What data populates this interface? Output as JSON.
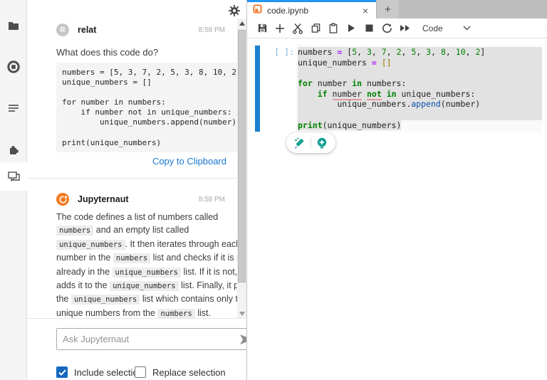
{
  "colors": {
    "accent_blue": "#2196f3",
    "brand_orange": "#f57c22",
    "teal_ai": "#12a192",
    "keyword_green": "#008000",
    "operator_magenta": "#aa22ff",
    "function_blue": "#0550ae",
    "selection_gray": "#e2e2e2",
    "checkbox_blue": "#1667c0"
  },
  "sidebar": {
    "items": [
      {
        "name": "file-browser"
      },
      {
        "name": "running-kernels"
      },
      {
        "name": "table-of-contents"
      },
      {
        "name": "extension-manager"
      },
      {
        "name": "chat",
        "selected": true
      }
    ]
  },
  "chat": {
    "user_message": {
      "author": "relat",
      "avatar_initial": "R",
      "time": "8:58 PM",
      "question": "What does this code do?",
      "code": "numbers = [5, 3, 7, 2, 5, 3, 8, 10, 2]\nunique_numbers = []\n\nfor number in numbers:\n    if number not in unique_numbers:\n        unique_numbers.append(number)\n\nprint(unique_numbers)",
      "copy_label": "Copy to Clipboard"
    },
    "ai_message": {
      "author": "Jupyternaut",
      "time": "8:58 PM",
      "segments": [
        {
          "type": "text",
          "text": "The code defines a list of numbers called "
        },
        {
          "type": "code",
          "text": "numbers"
        },
        {
          "type": "text",
          "text": " and an empty list called "
        },
        {
          "type": "code",
          "text": "unique_numbers"
        },
        {
          "type": "text",
          "text": ". It then iterates through each number in the "
        },
        {
          "type": "code",
          "text": "numbers"
        },
        {
          "type": "text",
          "text": " list and checks if it is not already in the "
        },
        {
          "type": "code",
          "text": "unique_numbers"
        },
        {
          "type": "text",
          "text": " list. If it is not, it adds it to the "
        },
        {
          "type": "code",
          "text": "unique_numbers"
        },
        {
          "type": "text",
          "text": " list. Finally, it prints the "
        },
        {
          "type": "code",
          "text": "unique_numbers"
        },
        {
          "type": "text",
          "text": " list which contains only the unique numbers from the "
        },
        {
          "type": "code",
          "text": "numbers"
        },
        {
          "type": "text",
          "text": " list."
        }
      ]
    },
    "input": {
      "placeholder": "Ask Jupyternaut",
      "value": ""
    },
    "checkboxes": [
      {
        "label": "Include selection",
        "checked": true
      },
      {
        "label": "Replace selection",
        "checked": false
      }
    ]
  },
  "notebook": {
    "tab": {
      "title": "code.ipynb"
    },
    "new_tab_label": "+",
    "toolbar": {
      "celltype": "Code"
    },
    "cell": {
      "prompt": "[ ]:",
      "lines": [
        {
          "sel": "full",
          "tokens": [
            {
              "t": "numbers "
            },
            {
              "t": "=",
              "c": "op"
            },
            {
              "t": " ["
            },
            {
              "t": "5",
              "c": "num"
            },
            {
              "t": ", "
            },
            {
              "t": "3",
              "c": "num"
            },
            {
              "t": ", "
            },
            {
              "t": "7",
              "c": "num"
            },
            {
              "t": ", "
            },
            {
              "t": "2",
              "c": "num"
            },
            {
              "t": ", "
            },
            {
              "t": "5",
              "c": "num"
            },
            {
              "t": ", "
            },
            {
              "t": "3",
              "c": "num"
            },
            {
              "t": ", "
            },
            {
              "t": "8",
              "c": "num"
            },
            {
              "t": ", "
            },
            {
              "t": "10",
              "c": "num"
            },
            {
              "t": ", "
            },
            {
              "t": "2",
              "c": "num"
            },
            {
              "t": "]"
            }
          ]
        },
        {
          "sel": "full",
          "tokens": [
            {
              "t": "unique_numbers "
            },
            {
              "t": "=",
              "c": "op"
            },
            {
              "t": " "
            },
            {
              "t": "[]",
              "c": "br"
            }
          ]
        },
        {
          "sel": "full",
          "tokens": []
        },
        {
          "sel": "full",
          "tokens": [
            {
              "t": "for",
              "c": "kw"
            },
            {
              "t": " number "
            },
            {
              "t": "in",
              "c": "kw"
            },
            {
              "t": " numbers:"
            }
          ]
        },
        {
          "sel": "full",
          "tokens": [
            {
              "t": "    "
            },
            {
              "t": "if",
              "c": "kw"
            },
            {
              "t": " "
            },
            {
              "t": "number",
              "c": "und"
            },
            {
              "t": " "
            },
            {
              "t": "not",
              "c": "kw und"
            },
            {
              "t": " "
            },
            {
              "t": "in",
              "c": "kw"
            },
            {
              "t": " unique_numbers:"
            }
          ]
        },
        {
          "sel": "full",
          "tokens": [
            {
              "t": "        unique_numbers."
            },
            {
              "t": "append",
              "c": "fn"
            },
            {
              "t": "(number)"
            }
          ]
        },
        {
          "sel": "full",
          "tokens": []
        },
        {
          "sel": "text",
          "tokens": [
            {
              "t": "print",
              "c": "kw"
            },
            {
              "t": "(unique_numbers)"
            }
          ]
        }
      ]
    }
  }
}
